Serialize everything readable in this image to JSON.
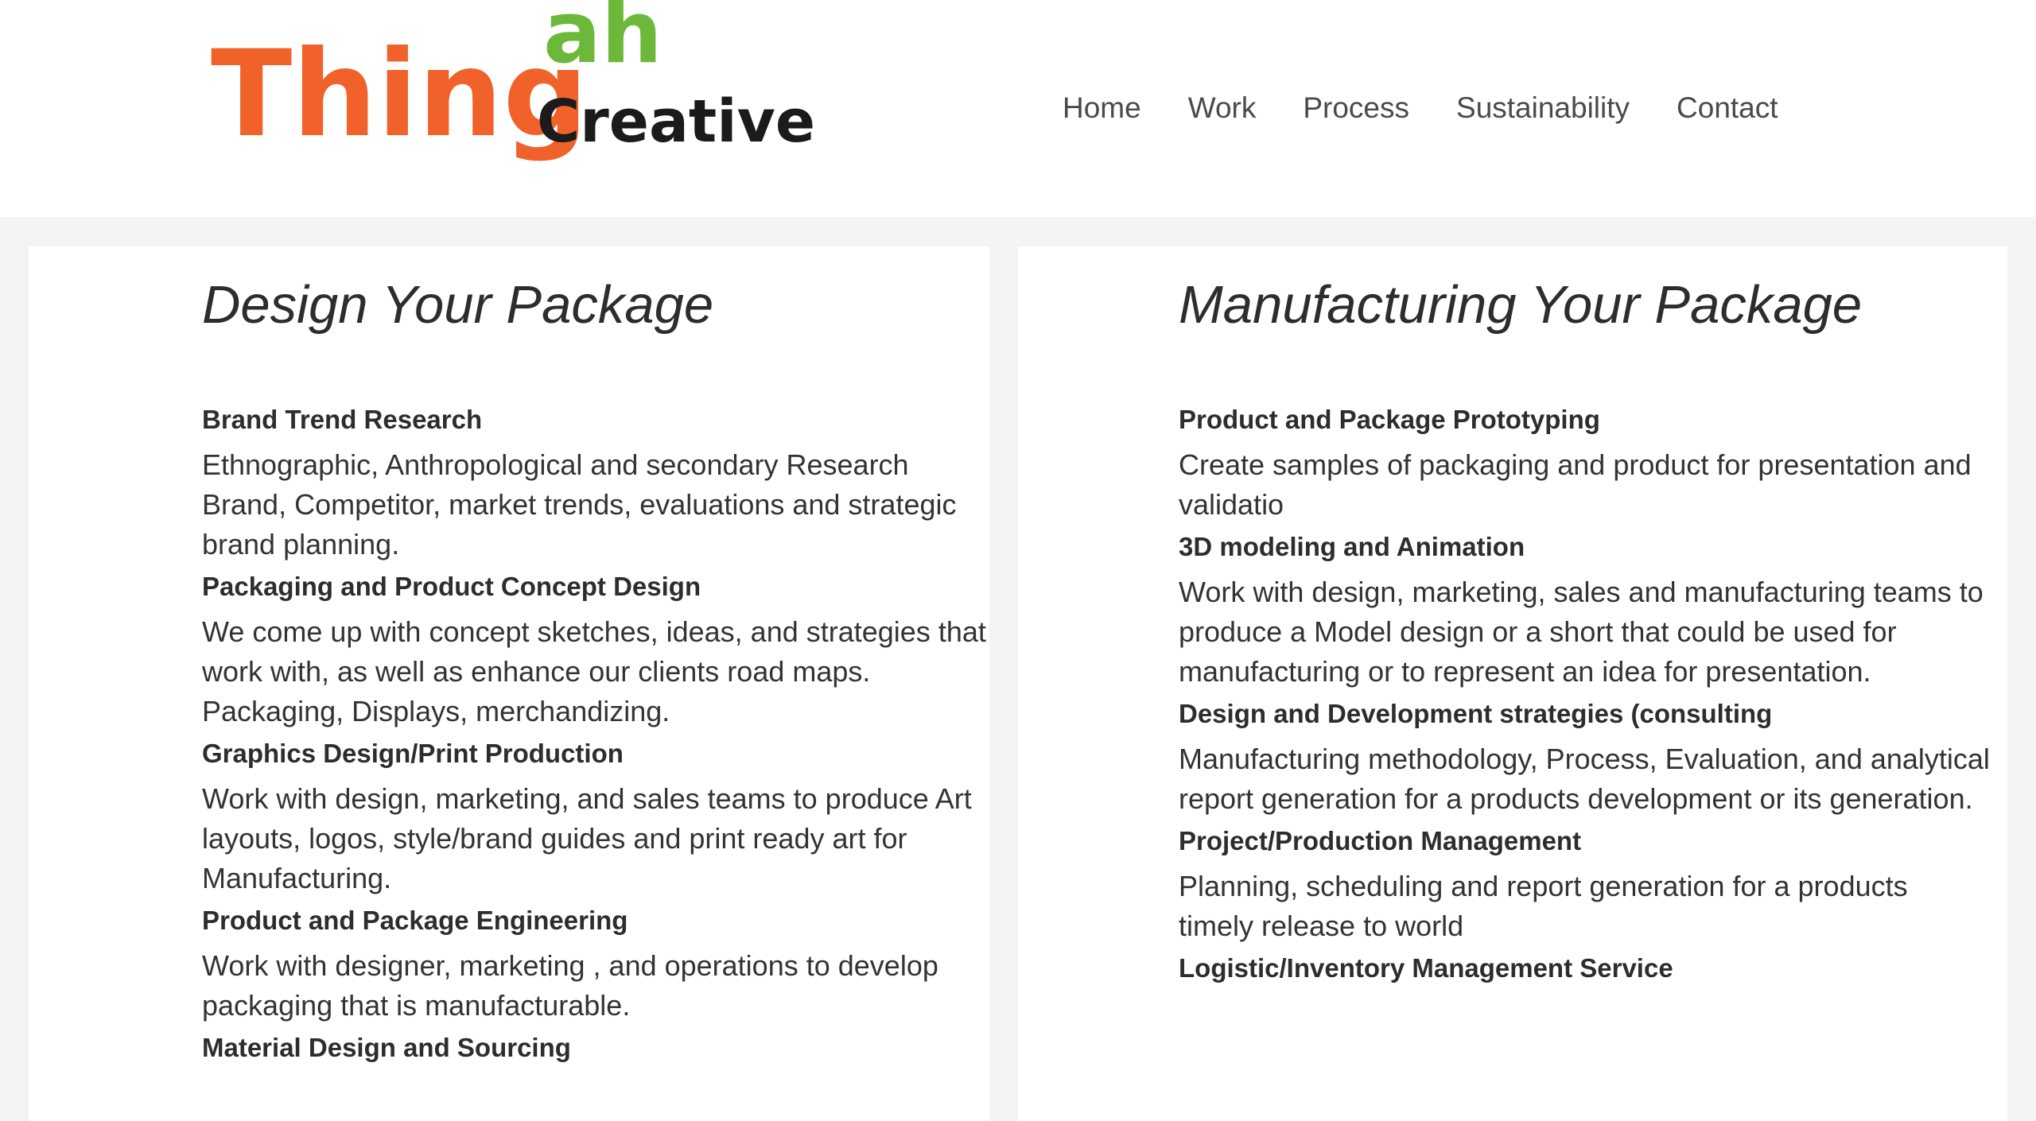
{
  "logo": {
    "word1": "Thing",
    "word2": "ah",
    "word3": "Creative...",
    "colors": {
      "thing": "#f0622a",
      "ah": "#6cb83a",
      "creative": "#1b1b1b"
    }
  },
  "nav": {
    "items": [
      {
        "label": "Home"
      },
      {
        "label": "Work"
      },
      {
        "label": "Process"
      },
      {
        "label": "Sustainability"
      },
      {
        "label": "Contact"
      }
    ]
  },
  "design": {
    "title": "Design Your Package",
    "items": [
      {
        "title": "Brand Trend Research",
        "desc": "Ethnographic, Anthropological and secondary Research Brand, Competitor, market trends, evaluations and strategic brand planning."
      },
      {
        "title": "Packaging and Product Concept Design",
        "desc": "We come up with concept sketches, ideas, and strategies that work with, as well as enhance our clients road maps. Packaging, Displays, merchandizing."
      },
      {
        "title": "Graphics Design/Print Production",
        "desc": "Work with design, marketing, and sales teams to produce Art layouts, logos, style/brand guides and print ready art for Manufacturing."
      },
      {
        "title": "Product and Package Engineering",
        "desc": "Work with designer, marketing , and operations to develop packaging that is manufacturable."
      },
      {
        "title": "Material Design and Sourcing",
        "desc": ""
      }
    ]
  },
  "manufacturing": {
    "title": "Manufacturing Your Package",
    "items": [
      {
        "title": "Product and Package Prototyping",
        "desc": "Create samples of packaging and product for presentation and validatio"
      },
      {
        "title": "3D modeling  and Animation",
        "desc": "Work with design, marketing, sales and manufacturing teams to produce a Model design or a short that could be used for manufacturing or to represent an idea for presentation."
      },
      {
        "title": "Design and Development strategies (consulting",
        "desc": "Manufacturing methodology, Process, Evaluation, and analytical report generation for a products development or its generation."
      },
      {
        "title": "Project/Production Management",
        "desc": "Planning, scheduling and report generation for a products timely release to world"
      },
      {
        "title": "Logistic/Inventory Management Service",
        "desc": ""
      }
    ]
  }
}
